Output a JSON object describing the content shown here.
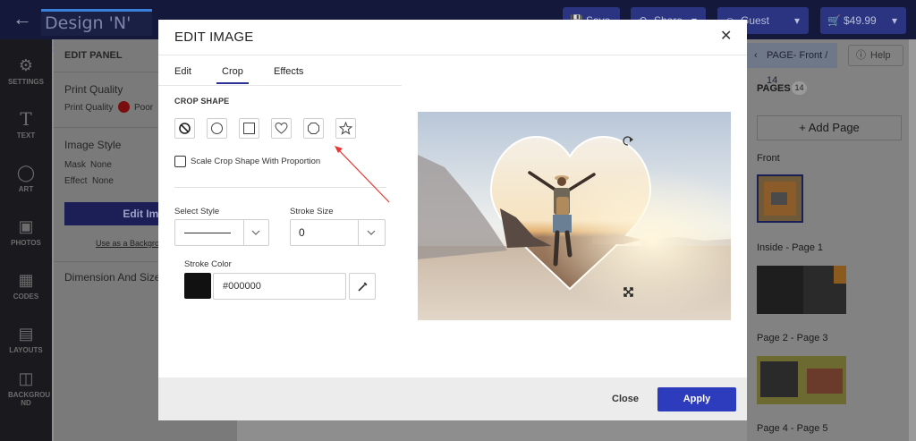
{
  "topbar": {
    "brand": "Design 'N' Buy",
    "save_label": "Save",
    "share_label": "Share",
    "guest_label": "Guest",
    "cart_price": "$49.99"
  },
  "rail": {
    "items": [
      {
        "label": "SETTINGS",
        "icon": "gear-icon"
      },
      {
        "label": "TEXT",
        "icon": "text-icon"
      },
      {
        "label": "ART",
        "icon": "art-icon"
      },
      {
        "label": "PHOTOS",
        "icon": "photos-icon"
      },
      {
        "label": "CODES",
        "icon": "qr-code-icon"
      },
      {
        "label": "LAYOUTS",
        "icon": "layouts-icon"
      },
      {
        "label": "BACKGROU ND",
        "icon": "background-icon"
      }
    ]
  },
  "edit_panel": {
    "title": "EDIT PANEL",
    "print_quality_heading": "Print Quality",
    "print_quality_label": "Print Quality",
    "print_quality_value": "Poor",
    "image_style_heading": "Image Style",
    "mask_label": "Mask",
    "mask_value": "None",
    "effect_label": "Effect",
    "effect_value": "None",
    "edit_button": "Edit Ima",
    "background_link": "Use as a Backgro",
    "dimension_heading": "Dimension And Size"
  },
  "pages_panel": {
    "page_selector": "PAGE- Front / 14",
    "help_label": "Help",
    "title": "PAGES",
    "count": "14",
    "add_page": "Add Page",
    "pages": [
      "Front",
      "Inside - Page 1",
      "Page 2 - Page 3",
      "Page 4 - Page 5"
    ]
  },
  "modal": {
    "title": "EDIT IMAGE",
    "tabs": [
      "Edit",
      "Crop",
      "Effects"
    ],
    "active_tab": "Crop",
    "crop_shape_heading": "CROP SHAPE",
    "shapes": [
      "none-shape-icon",
      "circle-shape-icon",
      "square-shape-icon",
      "heart-shape-icon",
      "octagon-shape-icon",
      "star-shape-icon"
    ],
    "scale_label": "Scale Crop Shape With Proportion",
    "select_style_label": "Select Style",
    "stroke_size_label": "Stroke Size",
    "stroke_size_value": "0",
    "stroke_color_label": "Stroke Color",
    "stroke_color_value": "#000000",
    "close_label": "Close",
    "apply_label": "Apply"
  },
  "colors": {
    "accent": "#2d3bbd",
    "active_tab_underline": "#2b3494",
    "annotation_arrow": "#e53935"
  }
}
